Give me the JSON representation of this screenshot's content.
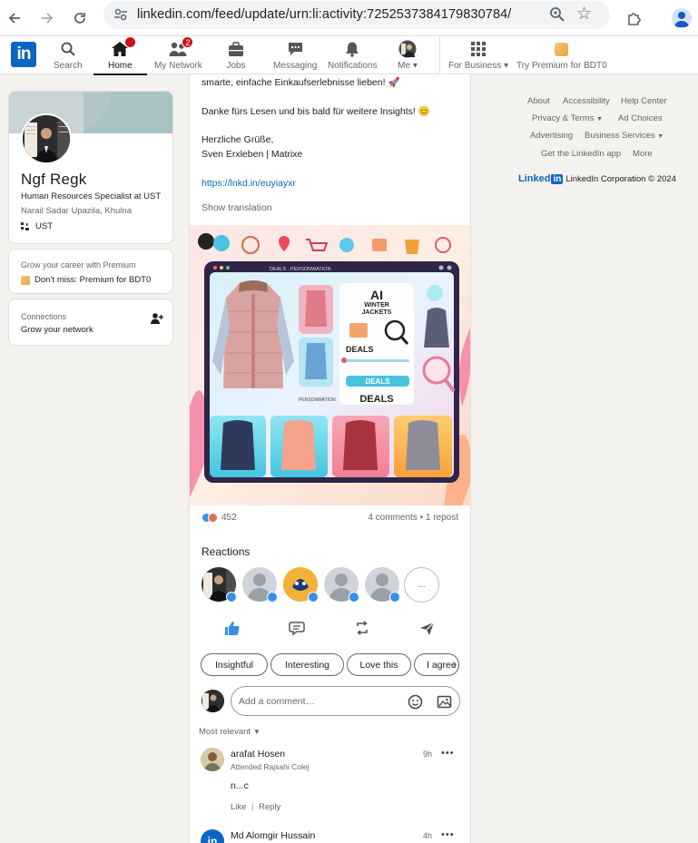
{
  "browser": {
    "url": "linkedin.com/feed/update/urn:li:activity:7252537384179830784/"
  },
  "nav": {
    "logo": "in",
    "items": [
      {
        "label": "Search"
      },
      {
        "label": "Home",
        "badge": ""
      },
      {
        "label": "My Network",
        "badge": "2"
      },
      {
        "label": "Jobs"
      },
      {
        "label": "Messaging"
      },
      {
        "label": "Notifications"
      },
      {
        "label": "Me"
      },
      {
        "label": "For Business"
      },
      {
        "label": "Try Premium for BDT0"
      }
    ]
  },
  "profile": {
    "name": "Ngf Regk",
    "headline": "Human Resources Specialist at UST",
    "location": "Narail Sadar Upazila, Khulna",
    "company": "UST"
  },
  "premium": {
    "line1": "Grow your career with Premium",
    "line2": "Don’t miss: Premium for BDT0"
  },
  "connections": {
    "label": "Connections",
    "sub": "Grow your network"
  },
  "post": {
    "text_line1": "smarte, einfache Einkaufserlebnisse lieben! 🚀",
    "text_line2": "Danke fürs Lesen und bis bald für weitere Insights! 😊",
    "text_line3": "Herzliche Grüße,",
    "text_line4": "Sven Erxleben | Matrixe",
    "link": "https://lnkd.in/euyiayxr",
    "show_translation": "Show translation",
    "image": {
      "header_text": "DEALS · PERSONWATION",
      "panel_title_1": "AI",
      "panel_title_2": "WINTER",
      "panel_title_3": "JACKETS",
      "deals_1": "DEALS",
      "deals_2": "DEALS",
      "deals_3": "DEALS",
      "personalization": "PERSONWATION"
    },
    "reaction_count": "452",
    "comments_reposts": "4 comments • 1 repost",
    "reactions_title": "Reactions",
    "reactions_more": "...",
    "chips": [
      "Insightful",
      "Interesting",
      "Love this",
      "I agree"
    ],
    "comment_placeholder": "Add a comment…",
    "sort": "Most relevant"
  },
  "comments": [
    {
      "name": "arafat Hosen",
      "sub": "Attended Rajsahi Colej",
      "time": "9h",
      "text": "n...c",
      "like": "Like",
      "reply": "Reply"
    },
    {
      "name": "Md Alomgir Hussain",
      "time": "4h"
    }
  ],
  "footer": {
    "about": "About",
    "accessibility": "Accessibility",
    "help": "Help Center",
    "privacy": "Privacy & Terms",
    "ad_choices": "Ad Choices",
    "advertising": "Advertising",
    "business": "Business Services",
    "app": "Get the LinkedIn app",
    "more": "More",
    "brand": "LinkedIn Corporation © 2024"
  },
  "colors": {
    "linkedin_blue": "#0a66c2",
    "badge_red": "#cc1016",
    "page_bg": "#f4f2ee"
  }
}
